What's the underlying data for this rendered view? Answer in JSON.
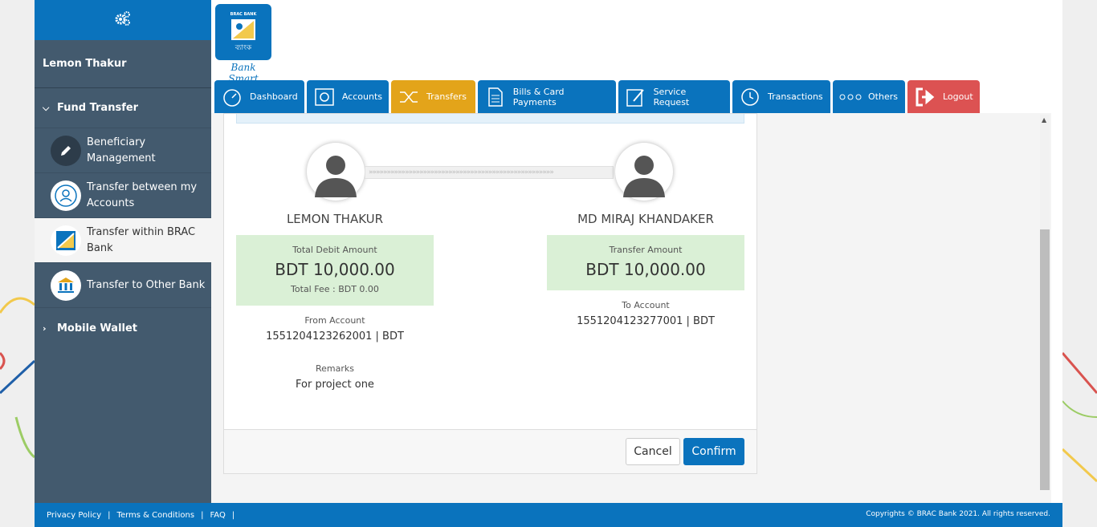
{
  "sidebar": {
    "user_name": "Lemon Thakur",
    "sections": [
      {
        "label": "Fund Transfer",
        "expanded": true
      },
      {
        "label": "Mobile Wallet",
        "expanded": false
      }
    ],
    "items": [
      {
        "label": "Beneficiary Management",
        "icon": "pencil-icon"
      },
      {
        "label": "Transfer between my Accounts",
        "icon": "account-transfer-icon"
      },
      {
        "label": "Transfer within BRAC Bank",
        "icon": "brac-logo-icon",
        "active": true
      },
      {
        "label": "Transfer to Other Bank",
        "icon": "bank-building-icon"
      }
    ]
  },
  "header": {
    "logo_caption": "Bank Smart",
    "logo_top_text": "BRAC BANK"
  },
  "nav": {
    "tabs": [
      {
        "label": "Dashboard",
        "icon": "speedometer-icon"
      },
      {
        "label": "Accounts",
        "icon": "safe-icon"
      },
      {
        "label": "Transfers",
        "icon": "shuffle-icon",
        "selected": true
      },
      {
        "label": "Bills & Card Payments",
        "icon": "document-icon"
      },
      {
        "label": "Service Request",
        "icon": "edit-icon"
      },
      {
        "label": "Transactions",
        "icon": "clock-icon"
      },
      {
        "label": "Others",
        "icon": "dots-icon"
      },
      {
        "label": "Logout",
        "icon": "logout-icon"
      }
    ]
  },
  "transfer": {
    "sender_name": "LEMON THAKUR",
    "receiver_name": "MD MIRAJ KHANDAKER",
    "debit_label": "Total Debit Amount",
    "debit_amount": "BDT  10,000.00",
    "fee_label": "Total Fee : ",
    "fee_value": "BDT 0.00",
    "transfer_label": "Transfer Amount",
    "transfer_amount": "BDT  10,000.00",
    "from_label": "From Account",
    "from_value": "1551204123262001 | BDT",
    "to_label": "To Account",
    "to_value": "1551204123277001 | BDT",
    "remarks_label": "Remarks",
    "remarks_value": "For project one",
    "arrows": "»»»»»»»»»»»»»»»»»»»»»»»»»»»»»»»»»»»»»»»»»»»»»»»»»»»"
  },
  "actions": {
    "cancel": "Cancel",
    "confirm": "Confirm"
  },
  "footer": {
    "privacy": "Privacy Policy",
    "terms": "Terms & Conditions",
    "faq": "FAQ",
    "copyright": "Copyrights © BRAC Bank 2021. All rights reserved."
  },
  "colors": {
    "brand_blue": "#0a73bd",
    "sidebar": "#435a6e",
    "selected_tab": "#e3a41a",
    "logout": "#dc5252",
    "amount_box": "#daf0d6"
  }
}
